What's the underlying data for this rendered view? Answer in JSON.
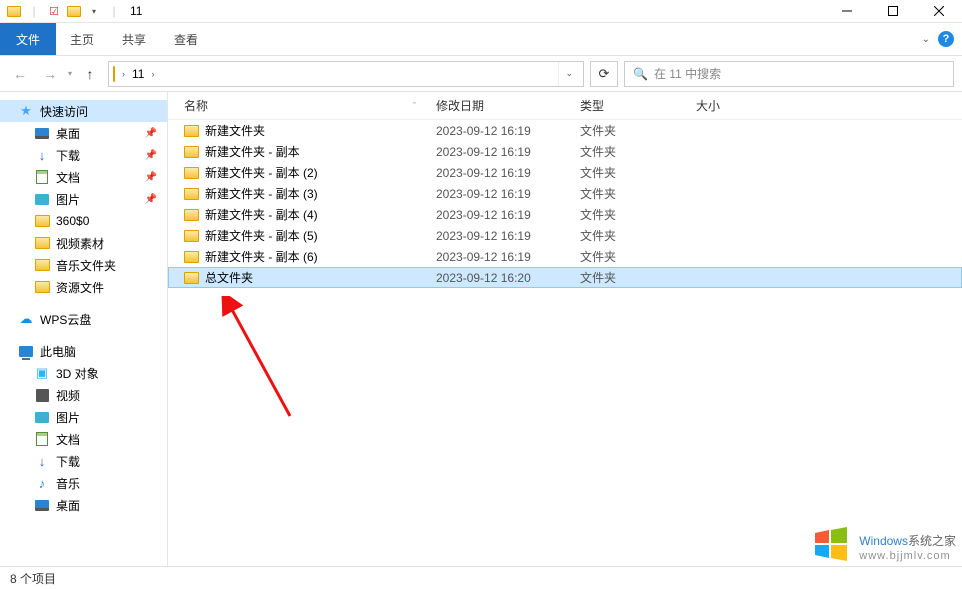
{
  "window": {
    "title": "11"
  },
  "ribbon": {
    "file": "文件",
    "tabs": [
      "主页",
      "共享",
      "查看"
    ]
  },
  "address": {
    "segment": "11",
    "search_placeholder": "在 11 中搜索"
  },
  "sidebar": {
    "quick_access": "快速访问",
    "items1": [
      {
        "label": "桌面",
        "pinned": true
      },
      {
        "label": "下载",
        "pinned": true
      },
      {
        "label": "文档",
        "pinned": true
      },
      {
        "label": "图片",
        "pinned": true
      },
      {
        "label": "360$0",
        "pinned": false
      },
      {
        "label": "视频素材",
        "pinned": false
      },
      {
        "label": "音乐文件夹",
        "pinned": false
      },
      {
        "label": "资源文件",
        "pinned": false
      }
    ],
    "wps": "WPS云盘",
    "this_pc": "此电脑",
    "items2": [
      {
        "label": "3D 对象"
      },
      {
        "label": "视频"
      },
      {
        "label": "图片"
      },
      {
        "label": "文档"
      },
      {
        "label": "下载"
      },
      {
        "label": "音乐"
      },
      {
        "label": "桌面"
      }
    ]
  },
  "columns": {
    "name": "名称",
    "date": "修改日期",
    "type": "类型",
    "size": "大小"
  },
  "files": [
    {
      "name": "新建文件夹",
      "date": "2023-09-12 16:19",
      "type": "文件夹",
      "selected": false
    },
    {
      "name": "新建文件夹 - 副本",
      "date": "2023-09-12 16:19",
      "type": "文件夹",
      "selected": false
    },
    {
      "name": "新建文件夹 - 副本 (2)",
      "date": "2023-09-12 16:19",
      "type": "文件夹",
      "selected": false
    },
    {
      "name": "新建文件夹 - 副本 (3)",
      "date": "2023-09-12 16:19",
      "type": "文件夹",
      "selected": false
    },
    {
      "name": "新建文件夹 - 副本 (4)",
      "date": "2023-09-12 16:19",
      "type": "文件夹",
      "selected": false
    },
    {
      "name": "新建文件夹 - 副本 (5)",
      "date": "2023-09-12 16:19",
      "type": "文件夹",
      "selected": false
    },
    {
      "name": "新建文件夹 - 副本 (6)",
      "date": "2023-09-12 16:19",
      "type": "文件夹",
      "selected": false
    },
    {
      "name": "总文件夹",
      "date": "2023-09-12 16:20",
      "type": "文件夹",
      "selected": true
    }
  ],
  "status": {
    "count_text": "8 个项目"
  },
  "watermark": {
    "brand": "Windows",
    "brand_zh": "系统之家",
    "url": "www.bjjmlv.com"
  }
}
